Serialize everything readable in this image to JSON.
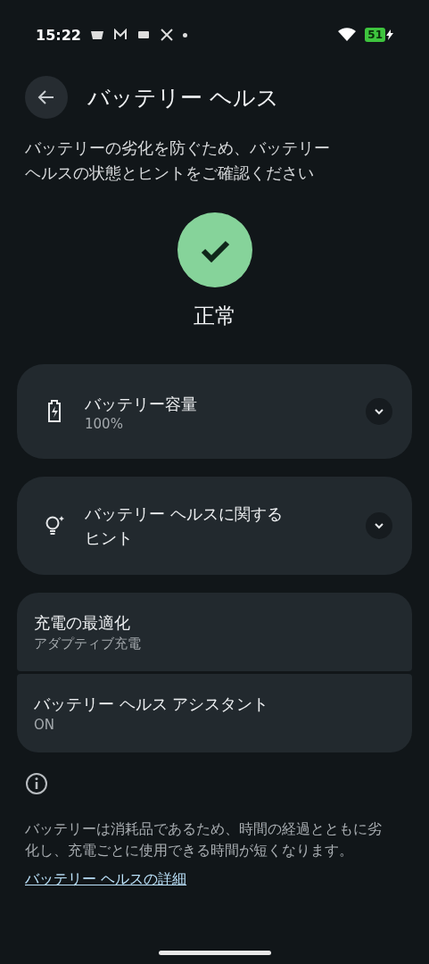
{
  "status_bar": {
    "time": "15:22",
    "battery": "51"
  },
  "header": {
    "title": "バッテリー ヘルス"
  },
  "description": "バッテリーの劣化を防ぐため、バッテリーヘルスの状態とヒントをご確認ください",
  "status": {
    "label": "正常",
    "ok": true
  },
  "cards": [
    {
      "kind": "battery",
      "title": "バッテリー容量",
      "subtitle": "100%",
      "expanded": false
    },
    {
      "kind": "tip",
      "title": "バッテリー ヘルスに関するヒント",
      "expanded": false
    }
  ],
  "settings": [
    {
      "title": "充電の最適化",
      "subtitle": "アダプティブ充電"
    },
    {
      "title": "バッテリー ヘルス アシスタント",
      "subtitle": "ON"
    }
  ],
  "footer": {
    "text": "バッテリーは消耗品であるため、時間の経過とともに劣化し、充電ごとに使用できる時間が短くなります。",
    "link": "バッテリー ヘルスの詳細"
  }
}
